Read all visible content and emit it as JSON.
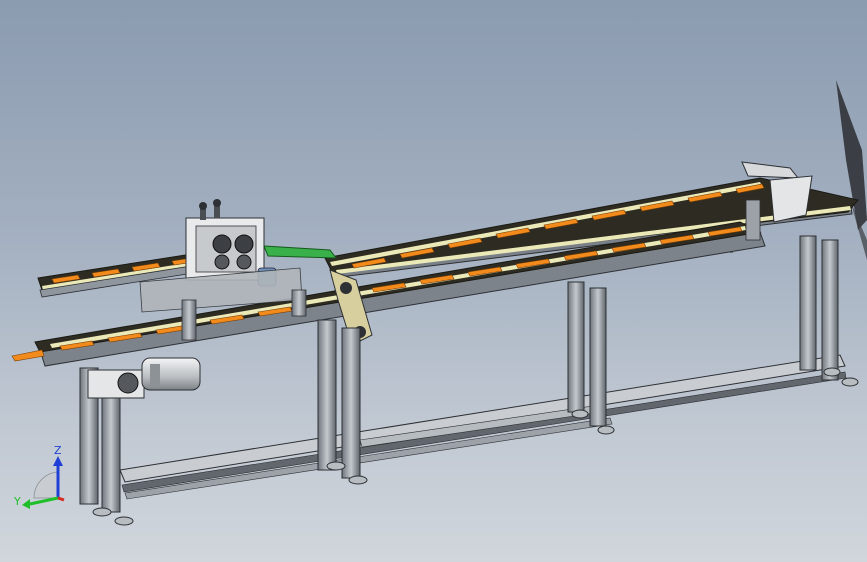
{
  "viewport": {
    "background_top": "#8b9bb0",
    "background_bottom": "#d1d6dc"
  },
  "model": {
    "frame_color": "#8f969e",
    "frame_dark": "#2d3034",
    "belt_color": "#2e2c22",
    "belt_light": "#ece9b8",
    "product_color": "#f28a1c",
    "guard_color": "#3ab04a",
    "motor_color": "#cfd2d4"
  },
  "triad": {
    "z_label": "Z",
    "y_label": "Y",
    "z_color": "#1f3fd6",
    "y_color": "#1fbf2a",
    "x_color": "#d62a1f"
  }
}
